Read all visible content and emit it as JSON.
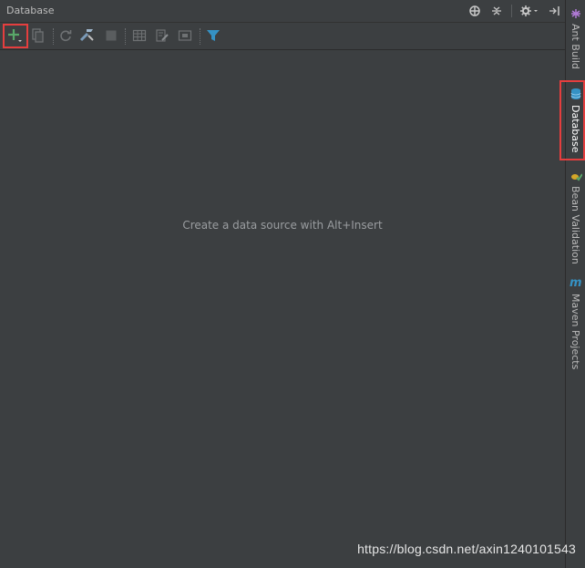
{
  "panel": {
    "title": "Database",
    "title_icons": [
      "crosshair-icon",
      "collapse-icon",
      "gear-icon",
      "hide-icon"
    ]
  },
  "toolbar": {
    "buttons": [
      {
        "name": "add-icon",
        "enabled": true
      },
      {
        "name": "copy-icon",
        "enabled": false
      },
      {
        "name": "refresh-icon",
        "enabled": false
      },
      {
        "name": "properties-icon",
        "enabled": true
      },
      {
        "name": "stop-icon",
        "enabled": false
      },
      {
        "name": "table-icon",
        "enabled": false
      },
      {
        "name": "edit-icon",
        "enabled": false
      },
      {
        "name": "console-icon",
        "enabled": false
      },
      {
        "name": "filter-icon",
        "enabled": true
      }
    ]
  },
  "content": {
    "empty_message": "Create a data source with Alt+Insert"
  },
  "sidebar": {
    "tabs": [
      {
        "label": "Ant Build",
        "icon": "ant-icon",
        "active": false
      },
      {
        "label": "Database",
        "icon": "database-icon",
        "active": true
      },
      {
        "label": "Bean Validation",
        "icon": "bean-icon",
        "active": false
      },
      {
        "label": "Maven Projects",
        "icon": "maven-icon",
        "active": false
      }
    ]
  },
  "watermark": "https://blog.csdn.net/axin1240101543",
  "colors": {
    "background": "#3c3f41",
    "highlight": "#e53e3e",
    "add_green": "#59a869",
    "filter_blue": "#3592c4"
  }
}
